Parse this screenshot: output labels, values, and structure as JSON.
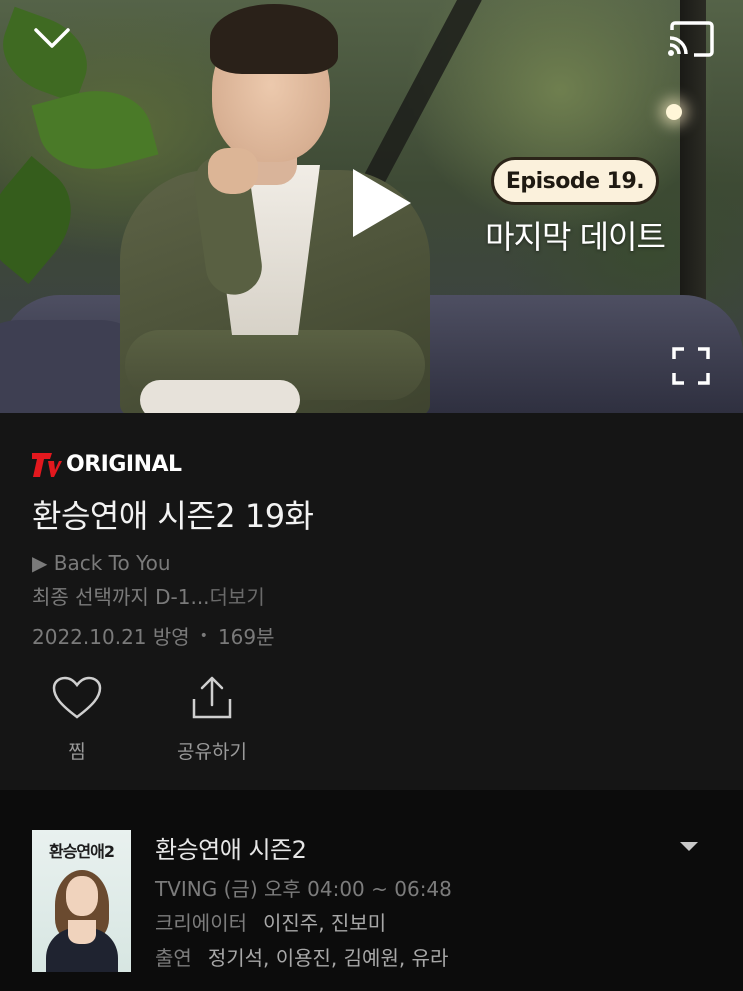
{
  "player": {
    "episode_badge": "Episode 19.",
    "episode_title": "마지막 데이트",
    "icons": [
      "chevron-down-icon",
      "cast-icon",
      "play-icon",
      "fullscreen-icon"
    ]
  },
  "info": {
    "brand": "ORIGINAL",
    "title": "환승연애 시즌2 19화",
    "description_line1": "▶ Back To You",
    "description_line2": "최종 선택까지 D-1...",
    "more_label": "더보기",
    "air_date": "2022.10.21 방영",
    "runtime": "169분",
    "actions": [
      {
        "label": "찜",
        "icon": "heart-icon"
      },
      {
        "label": "공유하기",
        "icon": "share-icon"
      }
    ]
  },
  "program": {
    "poster_title": "환승연애2",
    "title": "환승연애 시즌2",
    "schedule": "TVING (금) 오후 04:00 ~ 06:48",
    "creator_label": "크리에이터",
    "creators": "이진주, 진보미",
    "cast_label": "출연",
    "cast": "정기석, 이용진, 김예원, 유라"
  },
  "colors": {
    "background": "#151515",
    "brand_red": "#e3181e",
    "muted_text": "#7a7a7a"
  }
}
